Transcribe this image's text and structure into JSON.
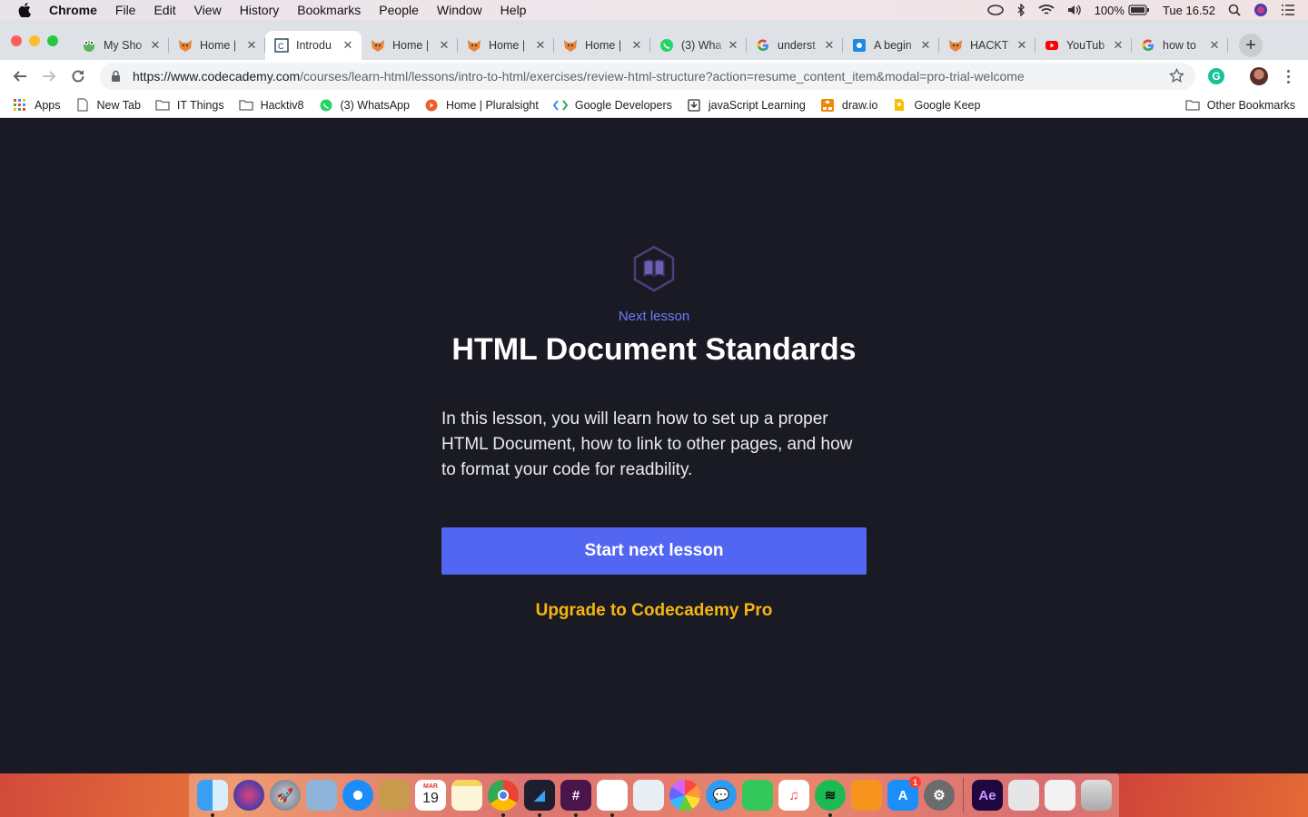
{
  "menubar": {
    "app": "Chrome",
    "items": [
      "File",
      "Edit",
      "View",
      "History",
      "Bookmarks",
      "People",
      "Window",
      "Help"
    ],
    "battery": "100%",
    "clock": "Tue 16.52"
  },
  "tabs": [
    {
      "title": "My Sho",
      "favicon": "frog-icon",
      "active": false
    },
    {
      "title": "Home |",
      "favicon": "fox-icon",
      "active": false
    },
    {
      "title": "Introdu",
      "favicon": "codecademy-icon",
      "active": true
    },
    {
      "title": "Home |",
      "favicon": "fox-icon",
      "active": false
    },
    {
      "title": "Home |",
      "favicon": "fox-icon",
      "active": false
    },
    {
      "title": "Home |",
      "favicon": "fox-icon",
      "active": false
    },
    {
      "title": "(3) Wha",
      "favicon": "whatsapp-icon",
      "active": false
    },
    {
      "title": "underst",
      "favicon": "google-icon",
      "active": false
    },
    {
      "title": "A begin",
      "favicon": "blue-square-icon",
      "active": false
    },
    {
      "title": "HACKT",
      "favicon": "fox-icon",
      "active": false
    },
    {
      "title": "YouTub",
      "favicon": "youtube-icon",
      "active": false
    },
    {
      "title": "how to",
      "favicon": "google-icon",
      "active": false
    }
  ],
  "toolbar": {
    "url_host": "https://www.codecademy.com",
    "url_path": "/courses/learn-html/lessons/intro-to-html/exercises/review-html-structure?action=resume_content_item&modal=pro-trial-welcome"
  },
  "bookmarks": [
    {
      "label": "Apps",
      "icon": "apps-grid-icon"
    },
    {
      "label": "New Tab",
      "icon": "page-icon"
    },
    {
      "label": "IT Things",
      "icon": "folder-icon"
    },
    {
      "label": "Hacktiv8",
      "icon": "folder-icon"
    },
    {
      "label": "(3) WhatsApp",
      "icon": "whatsapp-icon"
    },
    {
      "label": "Home | Pluralsight",
      "icon": "pluralsight-icon"
    },
    {
      "label": "Google Developers",
      "icon": "google-developers-icon"
    },
    {
      "label": "javaScript Learning",
      "icon": "download-icon"
    },
    {
      "label": "draw.io",
      "icon": "drawio-icon"
    },
    {
      "label": "Google Keep",
      "icon": "keep-icon"
    }
  ],
  "bookmarks_other": "Other Bookmarks",
  "lesson": {
    "label": "Next lesson",
    "title": "HTML Document Standards",
    "description": "In this lesson, you will learn how to set up a proper HTML Document, how to link to other pages, and how to format your code for readbility.",
    "start_button": "Start next lesson",
    "upgrade_link": "Upgrade to Codecademy Pro",
    "colors": {
      "accent": "#5266f2",
      "label": "#6b7cff",
      "upgrade": "#f5b70f",
      "background": "#1a1a24"
    }
  },
  "dock": {
    "calendar_month": "MAR",
    "calendar_day": "19",
    "appstore_badge": "1",
    "ae_label": "Ae"
  }
}
